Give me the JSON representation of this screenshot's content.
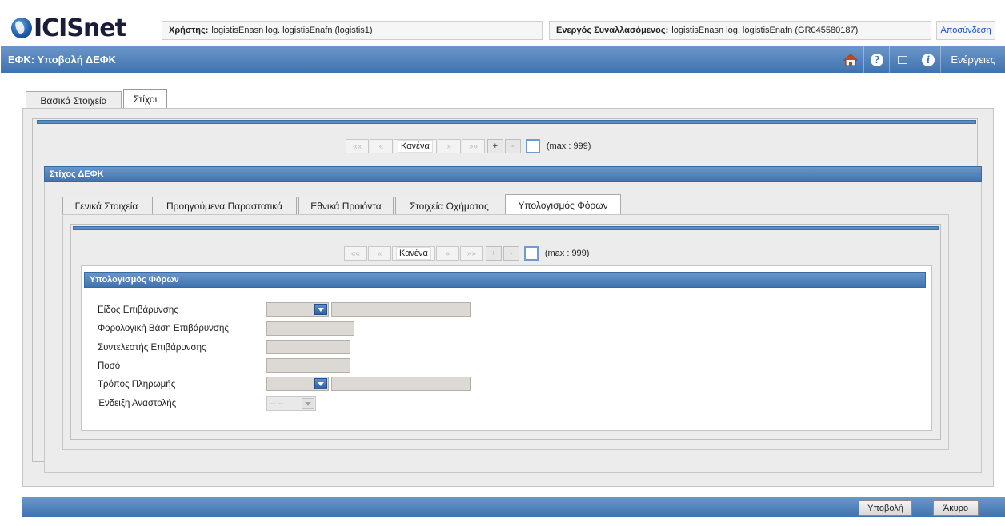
{
  "header": {
    "logo_text": "ICISnet",
    "user_label": "Χρήστης:",
    "user_value": "logistisEnasn log. logistisEnafn (logistis1)",
    "trader_label": "Ενεργός Συναλλασόμενος:",
    "trader_value": "logistisEnasn log. logistisEnafn (GR045580187)",
    "logout": "Αποσύνδεση"
  },
  "title_bar": {
    "title": "ΕΦΚ: Υποβολή ΔΕΦΚ",
    "actions": "Ενέργειες",
    "icons": [
      "home-icon",
      "help-icon",
      "window-icon",
      "info-icon"
    ]
  },
  "top_tabs": [
    "Βασικά Στοιχεία",
    "Στίχοι"
  ],
  "pager": {
    "first": "««",
    "prev": "«",
    "value": "Κανένα",
    "next": "»",
    "last": "»»",
    "add": "+",
    "remove": "-",
    "max": "(max : 999)"
  },
  "section_defk": "Στίχος ΔΕΦΚ",
  "inner_tabs": [
    "Γενικά Στοιχεία",
    "Προηγούμενα Παραστατικά",
    "Εθνικά Προιόντα",
    "Στοιχεία Οχήματος",
    "Υπολογισμός Φόρων"
  ],
  "section_tax": "Υπολογισμός Φόρων",
  "form": {
    "charge_type": "Είδος Επιβάρυνσης",
    "tax_base": "Φορολογική Βάση Επιβάρυνσης",
    "charge_rate": "Συντελεστής Επιβάρυνσης",
    "amount": "Ποσό",
    "payment_method": "Τρόπος Πληρωμής",
    "suspension": "Ένδειξη Αναστολής",
    "suspension_value": "-- --"
  },
  "footer": {
    "submit": "Υποβολή",
    "cancel": "Άκυρο"
  },
  "colors": {
    "accent": "#3f73b0",
    "panel": "#ececec"
  }
}
